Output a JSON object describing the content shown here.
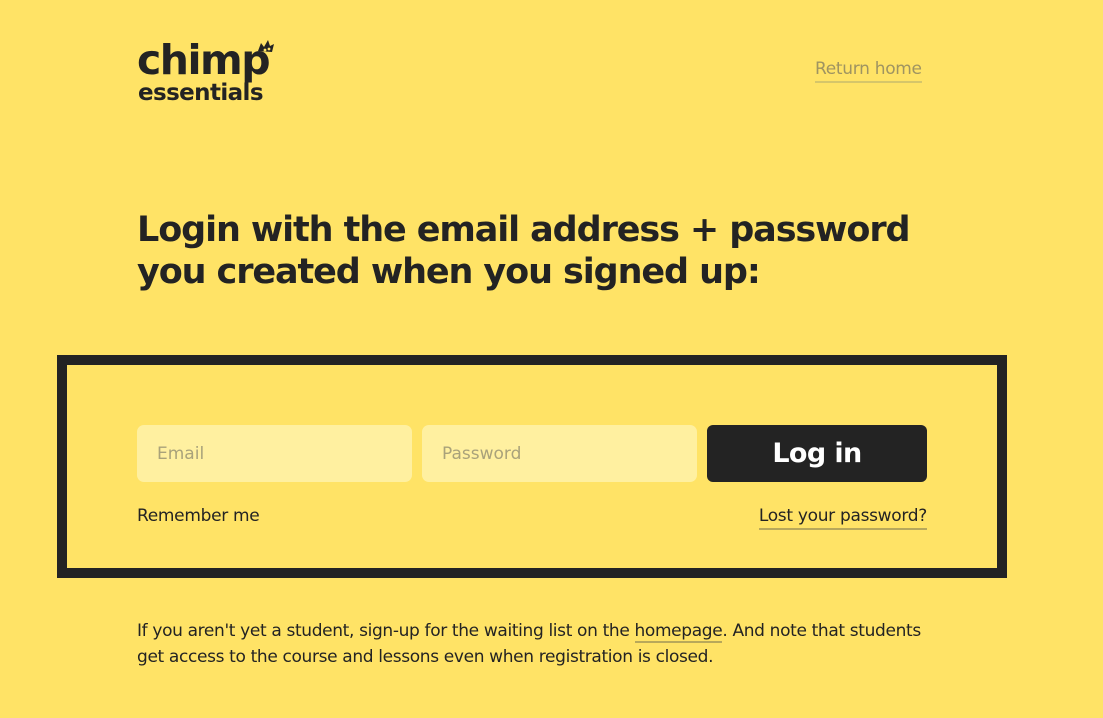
{
  "logo": {
    "line1": "chimp",
    "line2": "essentials",
    "mark_icon": "chimp-face-icon"
  },
  "header": {
    "return_home": "Return home"
  },
  "heading": {
    "line1": "Login with the email address + password",
    "line2": "you created when you signed up:"
  },
  "login_form": {
    "email_placeholder": "Email",
    "email_value": "",
    "password_placeholder": "Password",
    "password_value": "",
    "login_button": "Log in",
    "remember_me": "Remember me",
    "lost_password": "Lost your password?"
  },
  "note": {
    "before_link": "If you aren't yet a student, sign-up for the waiting list on the ",
    "link": "homepage",
    "after_link": ". And note that students get access to the course and lessons even when registration is closed."
  },
  "colors": {
    "background": "#ffe366",
    "text": "#232323",
    "input_bg": "#fff0a0",
    "button_bg": "#232323",
    "muted_link": "#9f9461"
  }
}
